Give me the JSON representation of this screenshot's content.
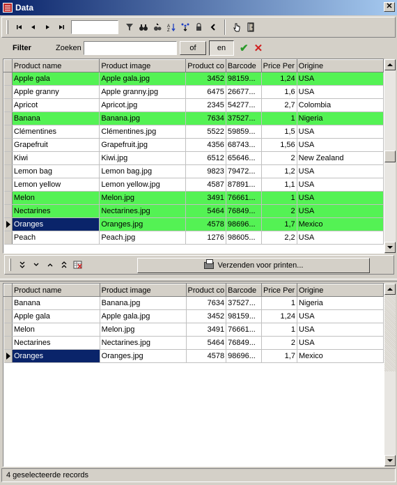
{
  "window": {
    "title": "Data"
  },
  "toolbar": {
    "nav_first": "first-record",
    "nav_prev": "previous-record",
    "nav_next": "next-record",
    "nav_last": "last-record",
    "record_value": ""
  },
  "filter": {
    "label": "Filter",
    "search_label": "Zoeken",
    "search_value": "",
    "or_button": "of",
    "and_button": "en"
  },
  "columns": [
    "Product name",
    "Product image",
    "Product co",
    "Barcode",
    "Price Per",
    "Origine"
  ],
  "top_grid": {
    "rows": [
      {
        "name": "Apple gala",
        "image": "Apple gala.jpg",
        "code": "3452",
        "barcode": "98159...",
        "price": "1,24",
        "origin": "USA",
        "selected": true
      },
      {
        "name": "Apple granny",
        "image": "Apple granny.jpg",
        "code": "6475",
        "barcode": "26677...",
        "price": "1,6",
        "origin": "USA",
        "selected": false
      },
      {
        "name": "Apricot",
        "image": "Apricot.jpg",
        "code": "2345",
        "barcode": "54277...",
        "price": "2,7",
        "origin": "Colombia",
        "selected": false
      },
      {
        "name": "Banana",
        "image": "Banana.jpg",
        "code": "7634",
        "barcode": "37527...",
        "price": "1",
        "origin": "Nigeria",
        "selected": true
      },
      {
        "name": "Clémentines",
        "image": "Clémentines.jpg",
        "code": "5522",
        "barcode": "59859...",
        "price": "1,5",
        "origin": "USA",
        "selected": false
      },
      {
        "name": "Grapefruit",
        "image": "Grapefruit.jpg",
        "code": "4356",
        "barcode": "68743...",
        "price": "1,56",
        "origin": "USA",
        "selected": false
      },
      {
        "name": "Kiwi",
        "image": "Kiwi.jpg",
        "code": "6512",
        "barcode": "65646...",
        "price": "2",
        "origin": "New Zealand",
        "selected": false
      },
      {
        "name": "Lemon bag",
        "image": "Lemon bag.jpg",
        "code": "9823",
        "barcode": "79472...",
        "price": "1,2",
        "origin": "USA",
        "selected": false
      },
      {
        "name": "Lemon yellow",
        "image": "Lemon yellow.jpg",
        "code": "4587",
        "barcode": "87891...",
        "price": "1,1",
        "origin": "USA",
        "selected": false
      },
      {
        "name": "Melon",
        "image": "Melon.jpg",
        "code": "3491",
        "barcode": "76661...",
        "price": "1",
        "origin": "USA",
        "selected": true
      },
      {
        "name": "Nectarines",
        "image": "Nectarines.jpg",
        "code": "5464",
        "barcode": "76849...",
        "price": "2",
        "origin": "USA",
        "selected": true
      },
      {
        "name": "Oranges",
        "image": "Oranges.jpg",
        "code": "4578",
        "barcode": "98696...",
        "price": "1,7",
        "origin": "Mexico",
        "selected": true,
        "current": true
      },
      {
        "name": "Peach",
        "image": "Peach.jpg",
        "code": "1276",
        "barcode": "98605...",
        "price": "2,2",
        "origin": "USA",
        "selected": false
      }
    ]
  },
  "bottom_toolbar": {
    "print_label": "Verzenden voor printen..."
  },
  "bottom_grid": {
    "rows": [
      {
        "name": "Banana",
        "image": "Banana.jpg",
        "code": "7634",
        "barcode": "37527...",
        "price": "1",
        "origin": "Nigeria"
      },
      {
        "name": "Apple gala",
        "image": "Apple gala.jpg",
        "code": "3452",
        "barcode": "98159...",
        "price": "1,24",
        "origin": "USA"
      },
      {
        "name": "Melon",
        "image": "Melon.jpg",
        "code": "3491",
        "barcode": "76661...",
        "price": "1",
        "origin": "USA"
      },
      {
        "name": "Nectarines",
        "image": "Nectarines.jpg",
        "code": "5464",
        "barcode": "76849...",
        "price": "2",
        "origin": "USA"
      },
      {
        "name": "Oranges",
        "image": "Oranges.jpg",
        "code": "4578",
        "barcode": "98696...",
        "price": "1,7",
        "origin": "Mexico",
        "current": true
      }
    ]
  },
  "status": {
    "text": "4 geselecteerde records"
  },
  "colors": {
    "selected_row": "#54f254",
    "current_cell": "#0a246a",
    "title_bar": "#0a246a"
  }
}
